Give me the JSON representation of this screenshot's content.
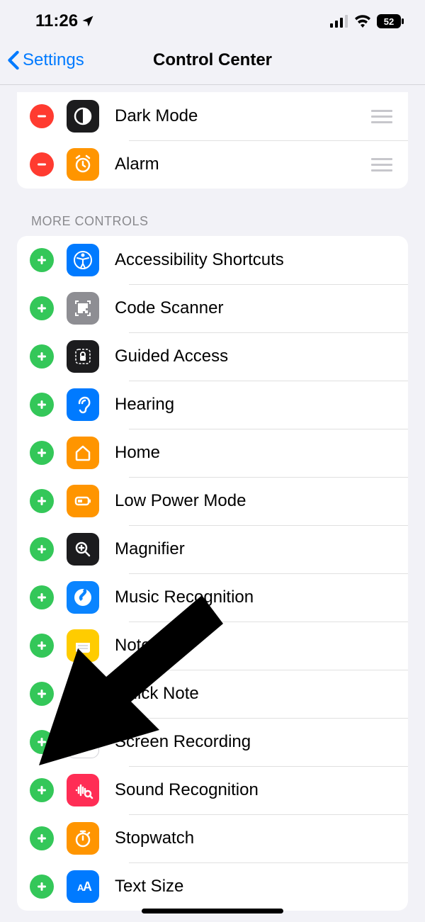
{
  "status": {
    "time": "11:26",
    "battery": "52"
  },
  "nav": {
    "back": "Settings",
    "title": "Control Center"
  },
  "section_more_header": "More Controls",
  "included": [
    {
      "label": "Dark Mode",
      "icon": "dark-mode-icon",
      "bg": "bg-black"
    },
    {
      "label": "Alarm",
      "icon": "alarm-icon",
      "bg": "bg-orange"
    }
  ],
  "more": [
    {
      "label": "Accessibility Shortcuts",
      "icon": "accessibility-icon",
      "bg": "bg-blue"
    },
    {
      "label": "Code Scanner",
      "icon": "qr-icon",
      "bg": "bg-gray"
    },
    {
      "label": "Guided Access",
      "icon": "lock-icon",
      "bg": "bg-black"
    },
    {
      "label": "Hearing",
      "icon": "ear-icon",
      "bg": "bg-blue"
    },
    {
      "label": "Home",
      "icon": "home-icon",
      "bg": "bg-orange"
    },
    {
      "label": "Low Power Mode",
      "icon": "battery-icon",
      "bg": "bg-orange"
    },
    {
      "label": "Magnifier",
      "icon": "magnifier-icon",
      "bg": "bg-black"
    },
    {
      "label": "Music Recognition",
      "icon": "shazam-icon",
      "bg": "bg-blue2"
    },
    {
      "label": "Notes",
      "icon": "notes-icon",
      "bg": "bg-yellow"
    },
    {
      "label": "Quick Note",
      "icon": "quicknote-icon",
      "bg": "bg-yellow"
    },
    {
      "label": "Screen Recording",
      "icon": "record-icon",
      "bg": "bg-white-ring"
    },
    {
      "label": "Sound Recognition",
      "icon": "sound-icon",
      "bg": "bg-red2"
    },
    {
      "label": "Stopwatch",
      "icon": "stopwatch-icon",
      "bg": "bg-orange"
    },
    {
      "label": "Text Size",
      "icon": "textsize-icon",
      "bg": "bg-blue"
    }
  ]
}
